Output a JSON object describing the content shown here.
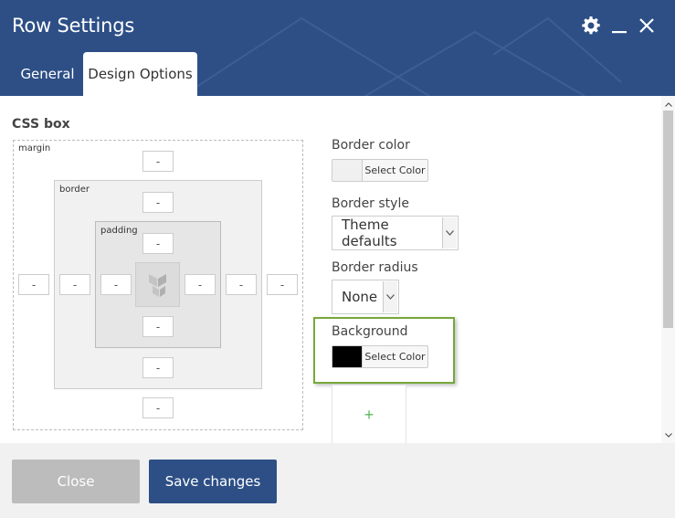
{
  "window": {
    "title": "Row Settings"
  },
  "header_icons": [
    "gear-icon",
    "minimize-icon",
    "close-icon"
  ],
  "tabs": [
    {
      "label": "General",
      "active": false
    },
    {
      "label": "Design Options",
      "active": true
    }
  ],
  "css_box": {
    "label": "CSS box",
    "margin_label": "margin",
    "border_label": "border",
    "padding_label": "padding",
    "margin": {
      "top": "-",
      "right": "-",
      "bottom": "-",
      "left": "-"
    },
    "border": {
      "top": "-",
      "right": "-",
      "bottom": "-",
      "left": "-"
    },
    "padding": {
      "top": "-",
      "right": "-",
      "bottom": "-",
      "left": "-"
    }
  },
  "border_color": {
    "label": "Border color",
    "button": "Select Color",
    "swatch": "#f0f0f0"
  },
  "border_style": {
    "label": "Border style",
    "value": "Theme defaults"
  },
  "border_radius": {
    "label": "Border radius",
    "value": "None"
  },
  "background": {
    "label": "Background",
    "button": "Select Color",
    "swatch": "#000000"
  },
  "add_image": {
    "symbol": "+"
  },
  "footer": {
    "close_label": "Close",
    "save_label": "Save changes"
  },
  "colors": {
    "header": "#2d4f86",
    "highlight": "#76a83b",
    "save_button": "#2d4f86",
    "close_button": "#bcbcbc"
  }
}
